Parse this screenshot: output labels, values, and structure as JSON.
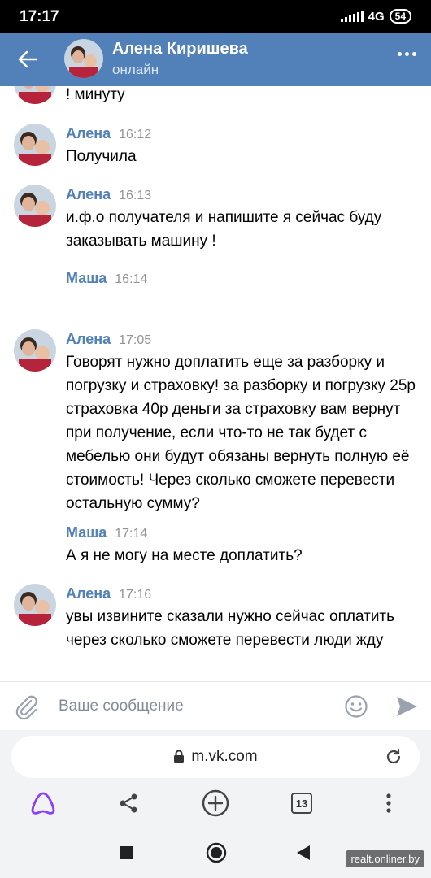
{
  "status_bar": {
    "time": "17:17",
    "network": "4G",
    "battery": "54"
  },
  "header": {
    "name": "Алена Киришева",
    "status": "онлайн",
    "back_icon": "arrow-left-icon",
    "menu_icon": "more-dots-icon"
  },
  "messages": [
    {
      "text": "! минуту"
    },
    {
      "author": "Алена",
      "time": "16:12",
      "text": "Получила"
    },
    {
      "author": "Алена",
      "time": "16:13",
      "text": "и.ф.о получателя и напишите я сейчас буду заказывать машину !"
    },
    {
      "author": "Маша",
      "time": "16:14",
      "text": ""
    },
    {
      "author": "Алена",
      "time": "17:05",
      "text": "Говорят нужно доплатить еще за разборку и погрузку и страховку! за разборку и погрузку 25р страховка 40р деньги за страховку вам вернут при получение, если что-то не так будет с мебелью они будут обязаны вернуть полную её стоимость! Через сколько сможете перевести остальную сумму?"
    },
    {
      "author": "Маша",
      "time": "17:14",
      "text": "А я не могу на месте доплатить?"
    },
    {
      "author": "Алена",
      "time": "17:16",
      "text": "увы извините сказали нужно сейчас оплатить через сколько сможете перевести люди жду"
    }
  ],
  "composer": {
    "placeholder": "Ваше сообщение"
  },
  "browser": {
    "url": "m.vk.com",
    "tabs_count": "13"
  },
  "watermark": "realt.onliner.by",
  "colors": {
    "header": "#5181b8",
    "author": "#5181b8",
    "timestamp": "#939393"
  }
}
